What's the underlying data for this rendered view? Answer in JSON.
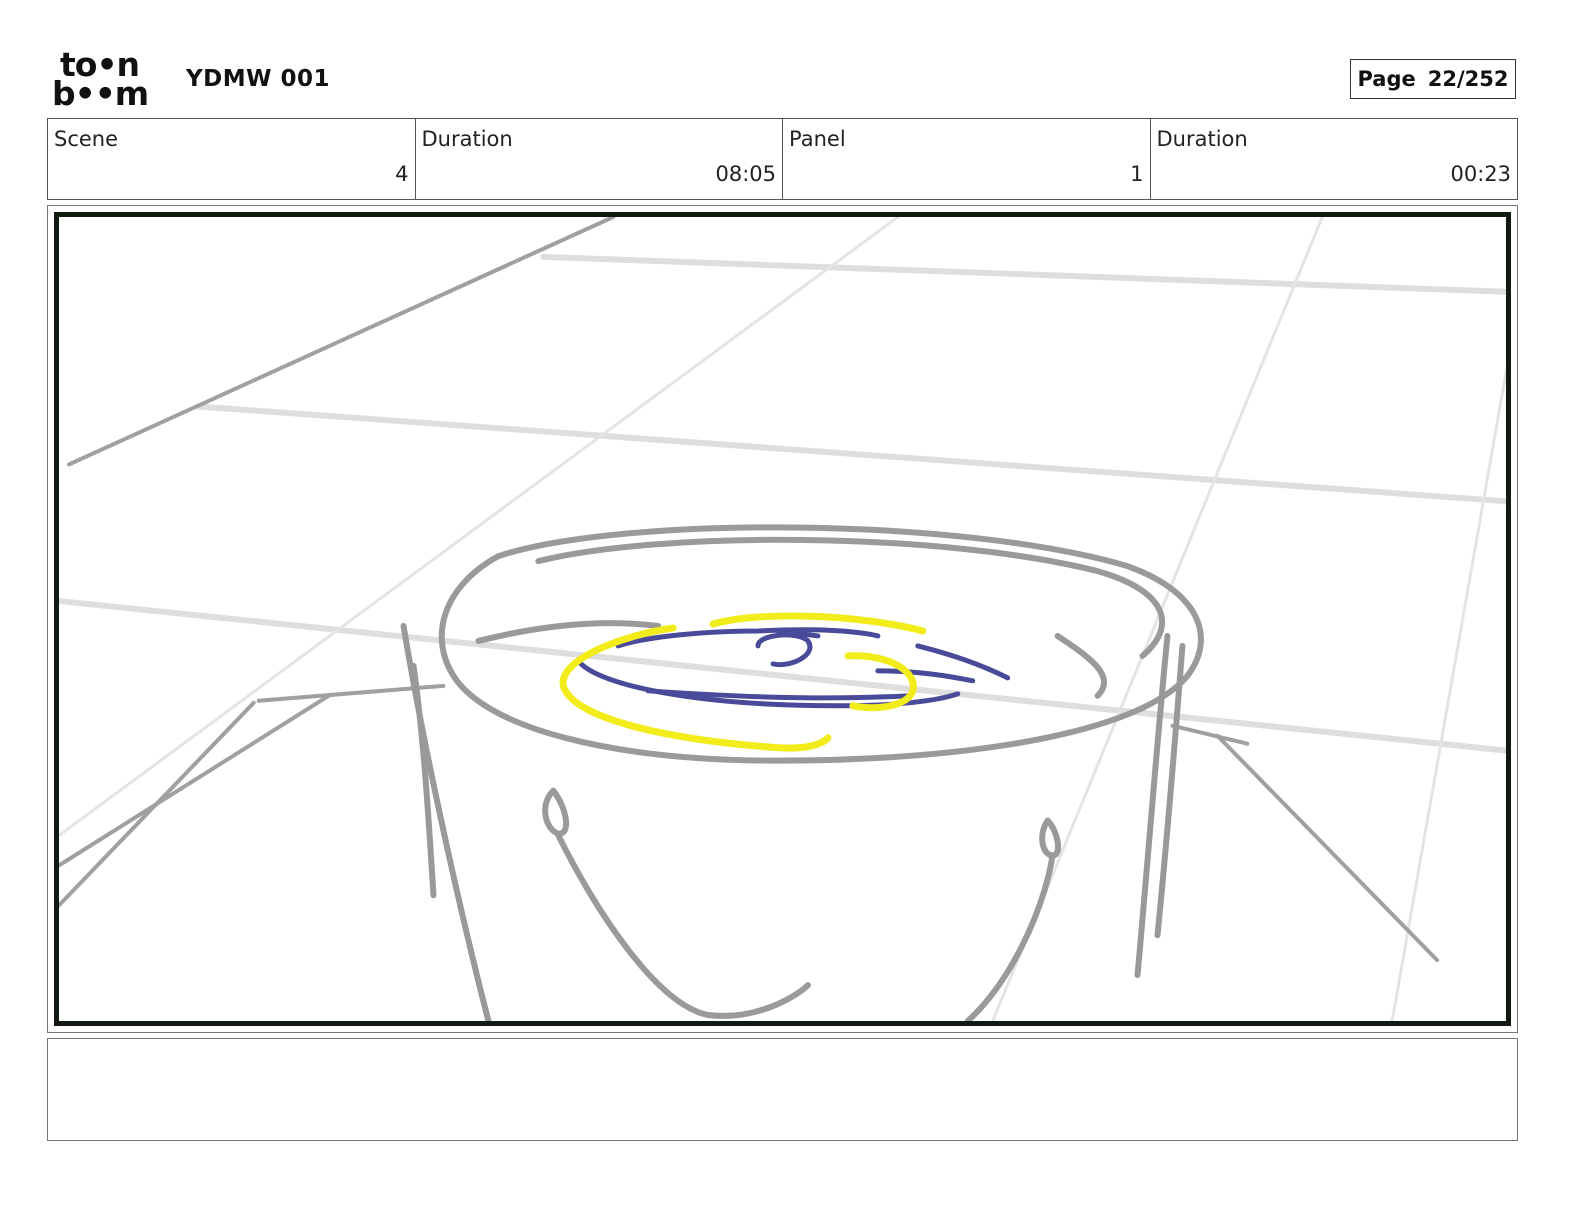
{
  "header": {
    "logo_top": "to•n",
    "logo_bottom": "b••m",
    "title": "YDMW 001",
    "page_label": "Page",
    "page_value": "22/252"
  },
  "info": [
    {
      "label": "Scene",
      "value": "4"
    },
    {
      "label": "Duration",
      "value": "08:05"
    },
    {
      "label": "Panel",
      "value": "1"
    },
    {
      "label": "Duration",
      "value": "00:23"
    }
  ],
  "colors": {
    "sketch_gray": "#9a9a9a",
    "floor_gray": "#dcdcdc",
    "highlight_yellow": "#f2ec1a",
    "water_blue": "#4a4a9a",
    "frame_border": "#101a10"
  },
  "notes": ""
}
